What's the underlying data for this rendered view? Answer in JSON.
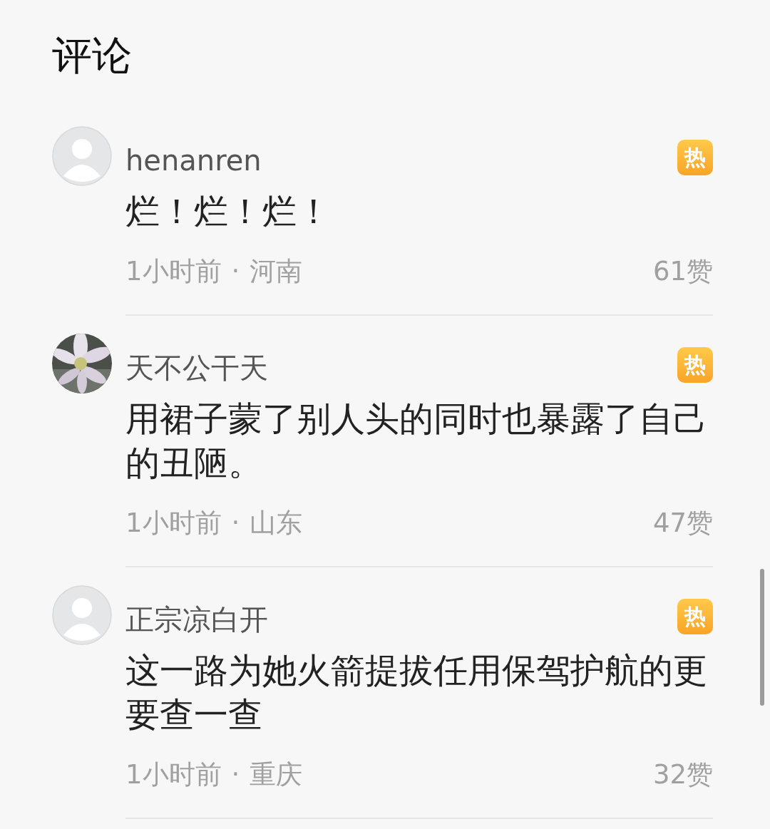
{
  "title": "评论",
  "comments": [
    {
      "avatar": {
        "kind": "default"
      },
      "name": "henanren",
      "badge": "热",
      "text": "烂！烂！烂！",
      "time": "1小时前",
      "dot": "·",
      "location": "河南",
      "likes": "61赞"
    },
    {
      "name": "天不公干天",
      "badge": "热",
      "text": "用裙子蒙了别人头的同时也暴露了自己的丑陋。",
      "time": "1小时前",
      "dot": "·",
      "location": "山东",
      "likes": "47赞"
    },
    {
      "avatar": {
        "kind": "default"
      },
      "name": "正宗凉白开",
      "badge": "热",
      "text": "这一路为她火箭提拔任用保驾护航的更要查一查",
      "time": "1小时前",
      "dot": "·",
      "location": "重庆",
      "likes": "32赞"
    }
  ]
}
